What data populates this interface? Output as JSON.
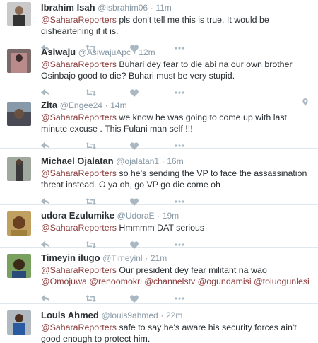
{
  "colors": {
    "mention": "#8b3a3a",
    "meta": "#8899a6",
    "icon": "#aab8c2",
    "divider": "#e1e8ed"
  },
  "icons": {
    "reply": "reply-icon",
    "retweet": "retweet-icon",
    "like": "heart-icon",
    "more": "more-icon",
    "geo": "location-pin-icon"
  },
  "tweets": [
    {
      "name": "Ibrahim Isah",
      "handle": "@isbrahim06",
      "sep": "·",
      "time": "11m",
      "mention": "@SaharaReporters",
      "text": " pls don't tell me this is true. It would be disheartening if it is."
    },
    {
      "name": "Asiwaju",
      "handle": "@AsiwajuApc",
      "sep": "·",
      "time": "12m",
      "mention": "@SaharaReporters",
      "text": " Buhari dey fear to die abi na our own brother Osinbajo good to die?  Buhari must be very stupid."
    },
    {
      "name": "Zita",
      "handle": "@Engee24",
      "sep": "·",
      "time": "14m",
      "mention": "@SaharaReporters",
      "text": "  we know he was going to come up with last minute excuse . This Fulani man self !!!"
    },
    {
      "name": "Michael Ojalatan",
      "handle": "@ojalatan1",
      "sep": "·",
      "time": "16m",
      "mention": "@SaharaReporters",
      "text": " so he's sending the VP to face the assassination threat instead. O ya oh, go  VP go die come oh"
    },
    {
      "name": "udora Ezulumike",
      "handle": "@UdoraE",
      "sep": "·",
      "time": "19m",
      "mention": "@SaharaReporters",
      "text": " Hmmmm DAT serious"
    },
    {
      "name": "Timeyin ilugo",
      "handle": "@Timeyinl",
      "sep": "·",
      "time": "21m",
      "mention": "@SaharaReporters",
      "text": " Our president dey fear militant na wao ",
      "extra_mentions": [
        "@Omojuwa",
        "@renoomokri",
        "@channelstv",
        "@ogundamisi",
        "@toluogunlesi"
      ]
    },
    {
      "name": "Louis Ahmed",
      "handle": "@louis9ahmed",
      "sep": "·",
      "time": "22m",
      "mention": "@SaharaReporters",
      "text": " safe to say he's aware  his security forces ain't good enough to protect him."
    }
  ]
}
